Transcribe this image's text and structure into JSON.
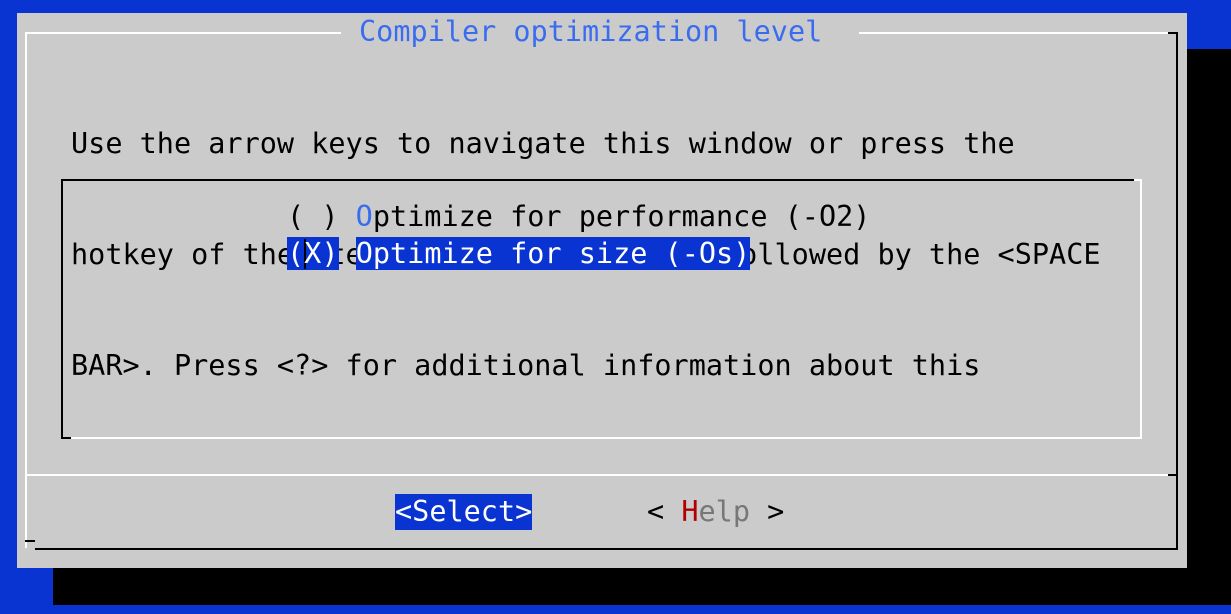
{
  "dialog": {
    "title": "Compiler optimization level",
    "instructions": [
      "Use the arrow keys to navigate this window or press the",
      "hotkey of the item you wish to select followed by the <SPACE",
      "BAR>. Press <?> for additional information about this"
    ]
  },
  "options": [
    {
      "marker": "( )",
      "hotkey": "O",
      "rest": "ptimize for performance (-O2)",
      "selected": false
    },
    {
      "marker_open": "(",
      "marker_x": "X",
      "marker_close": ")",
      "label": "Optimize for size (-Os)",
      "selected": true
    }
  ],
  "buttons": {
    "select_label": "<Select>",
    "help_left": "< ",
    "help_hotkey": "H",
    "help_rest": "elp",
    "help_right": " >"
  },
  "colors": {
    "background": "#0a34d2",
    "dialog": "#cbcbcb",
    "highlight": "#0a34d2",
    "title": "#3a6cf0",
    "hotkey_help": "#b00000"
  }
}
